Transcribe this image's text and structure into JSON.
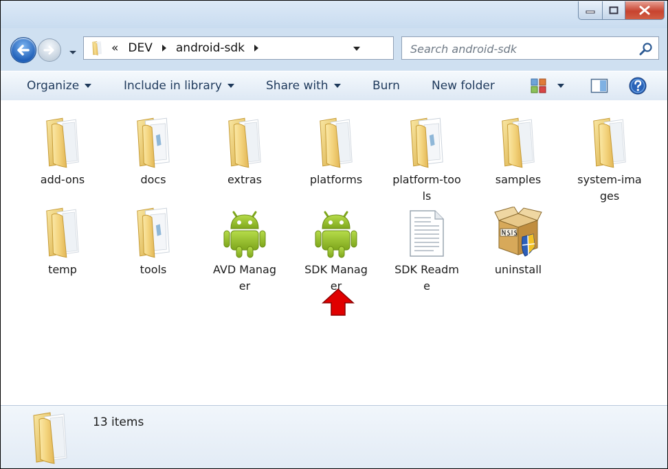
{
  "window": {
    "controls": {
      "minimize_icon": "minimize-icon",
      "maximize_icon": "maximize-icon",
      "close_icon": "close-icon"
    }
  },
  "nav": {
    "breadcrumb": {
      "overflow": "«",
      "segments": [
        "DEV",
        "android-sdk"
      ]
    },
    "search_placeholder": "Search android-sdk"
  },
  "toolbar": {
    "organize": "Organize",
    "include_in_library": "Include in library",
    "share_with": "Share with",
    "burn": "Burn",
    "new_folder": "New folder"
  },
  "items": [
    {
      "label": "add-ons",
      "icon": "folder-icon"
    },
    {
      "label": "docs",
      "icon": "folder-docs-icon"
    },
    {
      "label": "extras",
      "icon": "folder-icon"
    },
    {
      "label": "platforms",
      "icon": "folder-icon"
    },
    {
      "label": "platform-tools",
      "icon": "folder-docs-icon"
    },
    {
      "label": "samples",
      "icon": "folder-icon"
    },
    {
      "label": "system-images",
      "icon": "folder-icon"
    },
    {
      "label": "temp",
      "icon": "folder-icon"
    },
    {
      "label": "tools",
      "icon": "folder-docs-icon"
    },
    {
      "label": "AVD Manager",
      "icon": "android-icon"
    },
    {
      "label": "SDK Manager",
      "icon": "android-icon"
    },
    {
      "label": "SDK Readme",
      "icon": "text-document-icon"
    },
    {
      "label": "uninstall",
      "icon": "nsis-installer-icon"
    }
  ],
  "status": {
    "item_count": "13 items"
  },
  "colors": {
    "accent": "#1e395b",
    "folder": "#f2d27a",
    "android": "#97c024",
    "arrow": "#e00000"
  }
}
